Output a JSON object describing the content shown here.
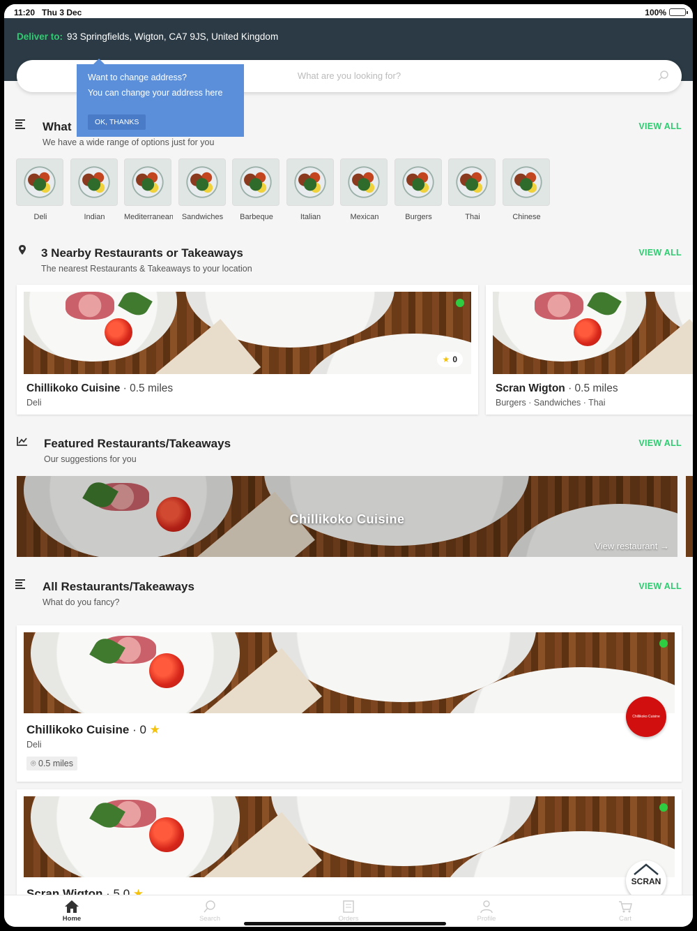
{
  "status_bar": {
    "time": "11:20",
    "date": "Thu 3 Dec",
    "battery": "100%"
  },
  "header": {
    "deliver_label": "Deliver to:",
    "address": "93 Springfields, Wigton, CA7 9JS, United Kingdom"
  },
  "search": {
    "placeholder": "What are you looking for?"
  },
  "tooltip": {
    "line1": "Want to change address?",
    "line2": "You can change your address here",
    "button": "OK, THANKS"
  },
  "categories_section": {
    "title": "What",
    "subtitle": "We have a wide range of options just for you",
    "view_all": "VIEW ALL",
    "items": [
      "Deli",
      "Indian",
      "Mediterranean",
      "Sandwiches",
      "Barbeque",
      "Italian",
      "Mexican",
      "Burgers",
      "Thai",
      "Chinese"
    ]
  },
  "nearby_section": {
    "title": "3 Nearby Restaurants or Takeaways",
    "subtitle": "The nearest Restaurants & Takeaways to your location",
    "view_all": "VIEW ALL",
    "cards": [
      {
        "name": "Chillikoko Cuisine",
        "distance": " · 0.5 miles",
        "cuisines": "Deli",
        "rating": "0"
      },
      {
        "name": "Scran Wigton",
        "distance": " · 0.5 miles",
        "cuisines": "Burgers · Sandwiches · Thai"
      }
    ]
  },
  "featured_section": {
    "title": "Featured Restaurants/Takeaways",
    "subtitle": "Our suggestions for you",
    "view_all": "VIEW ALL",
    "banner_title": "Chillikoko Cuisine",
    "banner_link": "View restaurant →"
  },
  "all_section": {
    "title": "All Restaurants/Takeaways",
    "subtitle": "What do you fancy?",
    "view_all": "VIEW ALL",
    "cards": [
      {
        "name": "Chillikoko Cuisine",
        "rating_text": " · 0 ",
        "cuisines": "Deli",
        "miles": "0.5 miles",
        "logo_text": "Chillikoko Cuisine"
      },
      {
        "name": "Scran Wigton",
        "rating_text": " · 5.0 ",
        "logo_text": "SCRAN"
      }
    ]
  },
  "tabbar": {
    "items": [
      "Home",
      "Search",
      "Orders",
      "Profile",
      "Cart"
    ],
    "active": "Home"
  },
  "colors": {
    "accent": "#2ecc71",
    "header_bg": "#2b3a44",
    "tooltip_bg": "#5b8fd9"
  }
}
